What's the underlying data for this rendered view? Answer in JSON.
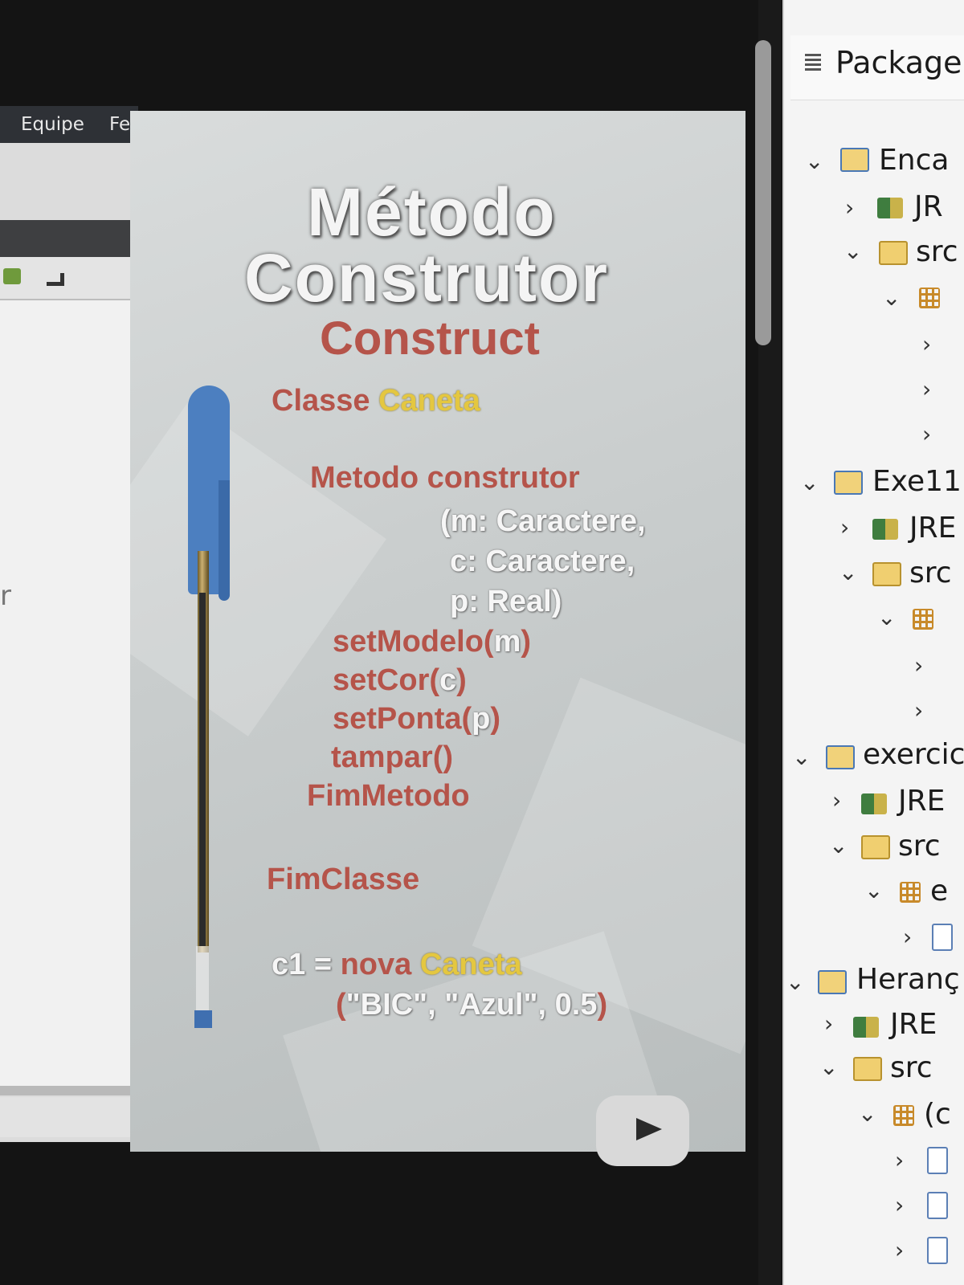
{
  "menubar": {
    "items": [
      "Equipe",
      "Fe"
    ]
  },
  "editor": {
    "stray_char": "r"
  },
  "slide": {
    "title_line1": "Método",
    "title_line2": "Construtor",
    "subtitle": "Construct",
    "code": {
      "classe_kw": "Classe",
      "classe_name": "Caneta",
      "metodo_kw": "Metodo construtor",
      "param1": "(m: Caractere,",
      "param2": "c: Caractere,",
      "param3": "p: Real)",
      "setmodelo_fn": "setModelo(",
      "setmodelo_arg": "m",
      "setmodelo_end": ")",
      "setcor_fn": "setCor(",
      "setcor_arg": "c",
      "setcor_end": ")",
      "setponta_fn": "setPonta(",
      "setponta_arg": "p",
      "setponta_end": ")",
      "tampar": "tampar()",
      "fimmetodo": "FimMetodo",
      "fimclasse": "FimClasse",
      "c1_var": "c1 =",
      "c1_nova": "nova",
      "c1_class": "Caneta",
      "args_open": "(",
      "args_values": "\"BIC\", \"Azul\", 0.5",
      "args_close": ")"
    }
  },
  "explorer": {
    "title": "Package",
    "tree": [
      {
        "label": "Enca",
        "type": "project"
      },
      {
        "label": "JR",
        "type": "jre"
      },
      {
        "label": "src",
        "type": "src"
      },
      {
        "label": "",
        "type": "package"
      },
      {
        "label": "",
        "type": "file"
      },
      {
        "label": "",
        "type": "file"
      },
      {
        "label": "",
        "type": "file"
      },
      {
        "label": "Exe11",
        "type": "project"
      },
      {
        "label": "JRE",
        "type": "jre"
      },
      {
        "label": "src",
        "type": "src"
      },
      {
        "label": "",
        "type": "package"
      },
      {
        "label": "",
        "type": "file"
      },
      {
        "label": "",
        "type": "file"
      },
      {
        "label": "exercic",
        "type": "project"
      },
      {
        "label": "JRE",
        "type": "jre"
      },
      {
        "label": "src",
        "type": "src"
      },
      {
        "label": "e",
        "type": "package"
      },
      {
        "label": "",
        "type": "file"
      },
      {
        "label": "Heranç",
        "type": "project"
      },
      {
        "label": "JRE",
        "type": "jre"
      },
      {
        "label": "src",
        "type": "src"
      },
      {
        "label": "(c",
        "type": "package"
      },
      {
        "label": "",
        "type": "file"
      },
      {
        "label": "",
        "type": "file"
      },
      {
        "label": "",
        "type": "file"
      }
    ]
  }
}
